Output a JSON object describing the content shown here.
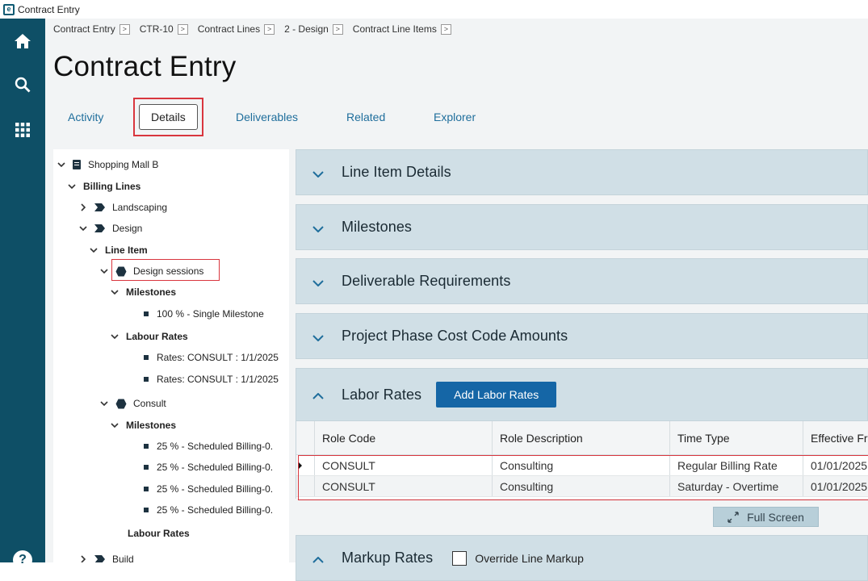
{
  "window": {
    "title": "Contract Entry",
    "app_icon": "e"
  },
  "sidebar": {
    "items": [
      "home-icon",
      "search-icon",
      "apps-grid-icon"
    ],
    "help": "?"
  },
  "breadcrumb": [
    {
      "label": "Contract Entry"
    },
    {
      "label": "CTR-10"
    },
    {
      "label": "Contract Lines"
    },
    {
      "label": "2 - Design"
    },
    {
      "label": "Contract Line Items"
    }
  ],
  "page_title": "Contract Entry",
  "tabs": {
    "activity": "Activity",
    "details": "Details",
    "deliverables": "Deliverables",
    "related": "Related",
    "explorer": "Explorer"
  },
  "tree": {
    "root": "Shopping Mall B",
    "billing_lines": "Billing Lines",
    "landscaping": "Landscaping",
    "design": "Design",
    "line_item": "Line Item",
    "design_sessions": "Design sessions",
    "milestones_1": "Milestones",
    "milestone_single": "100 % - Single Milestone",
    "labour_rates_1": "Labour Rates",
    "rate_1": "Rates: CONSULT : 1/1/2025",
    "rate_2": "Rates: CONSULT : 1/1/2025",
    "consult": "Consult",
    "milestones_2": "Milestones",
    "sched_1": "25 % - Scheduled Billing-0.",
    "sched_2": "25 % - Scheduled Billing-0.",
    "sched_3": "25 % - Scheduled Billing-0.",
    "sched_4": "25 % - Scheduled Billing-0.",
    "labour_rates_2": "Labour Rates",
    "build": "Build"
  },
  "sections": {
    "line_item_details": "Line Item Details",
    "milestones": "Milestones",
    "deliverable_requirements": "Deliverable Requirements",
    "project_phase": "Project Phase Cost Code Amounts",
    "labor_rates": "Labor Rates",
    "add_labor_rates": "Add Labor Rates",
    "markup_rates": "Markup Rates",
    "override_line_markup": "Override Line Markup"
  },
  "grid": {
    "headers": [
      "Role Code",
      "Role Description",
      "Time Type",
      "Effective Fr"
    ],
    "rows": [
      [
        "CONSULT",
        "Consulting",
        "Regular Billing Rate",
        "01/01/2025"
      ],
      [
        "CONSULT",
        "Consulting",
        "Saturday - Overtime",
        "01/01/2025"
      ]
    ]
  },
  "full_screen": "Full Screen",
  "colors": {
    "sidebar": "#0e4f66",
    "accent": "#1566a6",
    "link": "#1f6e9c",
    "highlight": "#d9363e",
    "section_bg": "#d0dfe6"
  }
}
